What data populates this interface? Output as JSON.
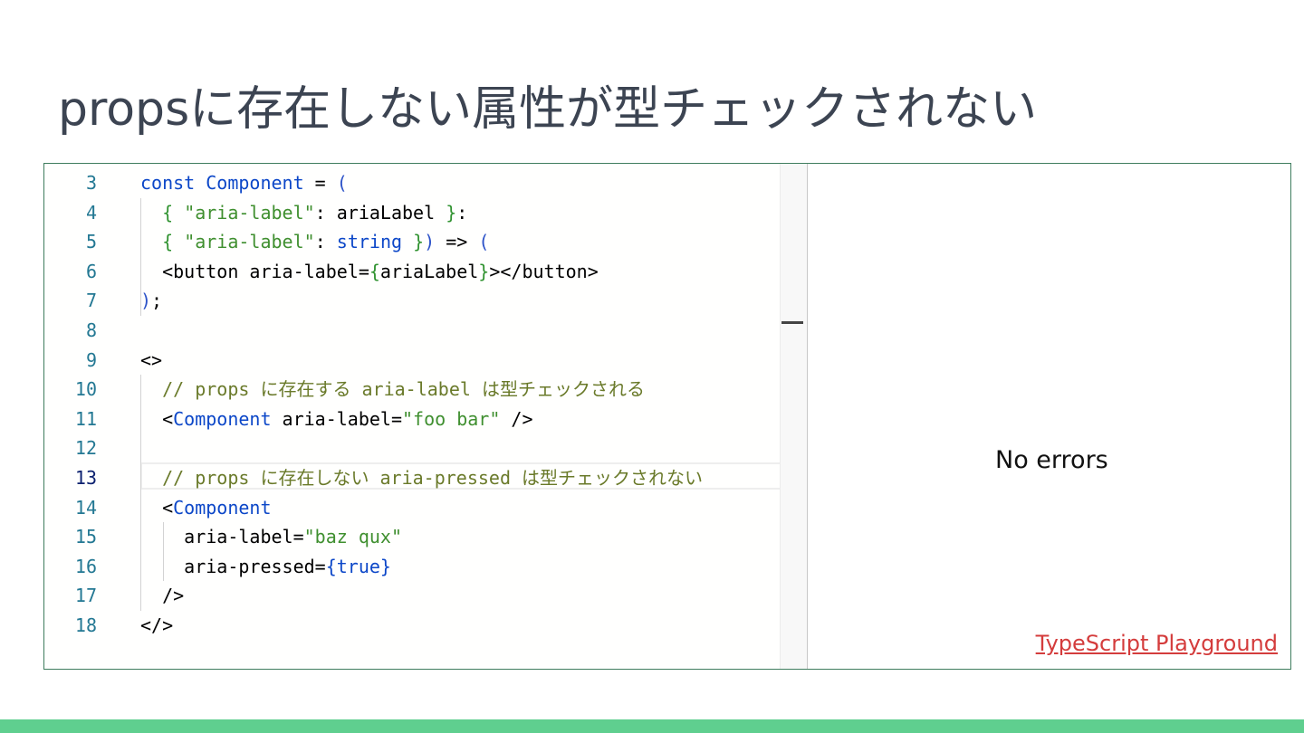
{
  "slide": {
    "title": "propsに存在しない属性が型チェックされない"
  },
  "editor": {
    "active_line": 13,
    "lines": [
      {
        "n": "3",
        "tokens": [
          {
            "t": "const ",
            "c": "kw2"
          },
          {
            "t": "Component",
            "c": "kw2"
          },
          {
            "t": " = ",
            "c": ""
          },
          {
            "t": "(",
            "c": "br2"
          }
        ]
      },
      {
        "n": "4",
        "tokens": [
          {
            "t": "  ",
            "c": ""
          },
          {
            "t": "{ ",
            "c": "br"
          },
          {
            "t": "\"aria-label\"",
            "c": "str"
          },
          {
            "t": ": ariaLabel ",
            "c": ""
          },
          {
            "t": "}",
            "c": "br"
          },
          {
            "t": ":",
            "c": ""
          }
        ]
      },
      {
        "n": "5",
        "tokens": [
          {
            "t": "  ",
            "c": ""
          },
          {
            "t": "{ ",
            "c": "br"
          },
          {
            "t": "\"aria-label\"",
            "c": "str"
          },
          {
            "t": ": ",
            "c": ""
          },
          {
            "t": "string",
            "c": "kw2"
          },
          {
            "t": " }",
            "c": "br"
          },
          {
            "t": ")",
            "c": "br2"
          },
          {
            "t": " => ",
            "c": ""
          },
          {
            "t": "(",
            "c": "br2"
          }
        ]
      },
      {
        "n": "6",
        "tokens": [
          {
            "t": "  <button aria-label=",
            "c": ""
          },
          {
            "t": "{",
            "c": "br"
          },
          {
            "t": "ariaLabel",
            "c": ""
          },
          {
            "t": "}",
            "c": "br"
          },
          {
            "t": "></button>",
            "c": ""
          }
        ]
      },
      {
        "n": "7",
        "tokens": [
          {
            "t": ")",
            "c": "br2"
          },
          {
            "t": ";",
            "c": ""
          }
        ]
      },
      {
        "n": "8",
        "tokens": []
      },
      {
        "n": "9",
        "tokens": [
          {
            "t": "<>",
            "c": ""
          }
        ]
      },
      {
        "n": "10",
        "tokens": [
          {
            "t": "  // props に存在する aria-label は型チェックされる",
            "c": "cm"
          }
        ]
      },
      {
        "n": "11",
        "tokens": [
          {
            "t": "  <",
            "c": ""
          },
          {
            "t": "Component",
            "c": "kw2"
          },
          {
            "t": " aria-label=",
            "c": ""
          },
          {
            "t": "\"foo bar\"",
            "c": "str"
          },
          {
            "t": " />",
            "c": ""
          }
        ]
      },
      {
        "n": "12",
        "tokens": []
      },
      {
        "n": "13",
        "tokens": [
          {
            "t": "  // props に存在しない aria-pressed は型チェックされない",
            "c": "cm"
          }
        ]
      },
      {
        "n": "14",
        "tokens": [
          {
            "t": "  <",
            "c": ""
          },
          {
            "t": "Component",
            "c": "kw2"
          }
        ]
      },
      {
        "n": "15",
        "tokens": [
          {
            "t": "    aria-label=",
            "c": ""
          },
          {
            "t": "\"baz qux\"",
            "c": "str"
          }
        ]
      },
      {
        "n": "16",
        "tokens": [
          {
            "t": "    aria-pressed=",
            "c": ""
          },
          {
            "t": "{true}",
            "c": "kw2"
          }
        ]
      },
      {
        "n": "17",
        "tokens": [
          {
            "t": "  />",
            "c": ""
          }
        ]
      },
      {
        "n": "18",
        "tokens": [
          {
            "t": "</>",
            "c": ""
          }
        ]
      }
    ]
  },
  "output": {
    "status": "No errors"
  },
  "link": {
    "label": "TypeScript Playground"
  },
  "colors": {
    "accent_bar": "#5fcf8f",
    "frame_border": "#3f7d5e",
    "link": "#d43c3c"
  }
}
